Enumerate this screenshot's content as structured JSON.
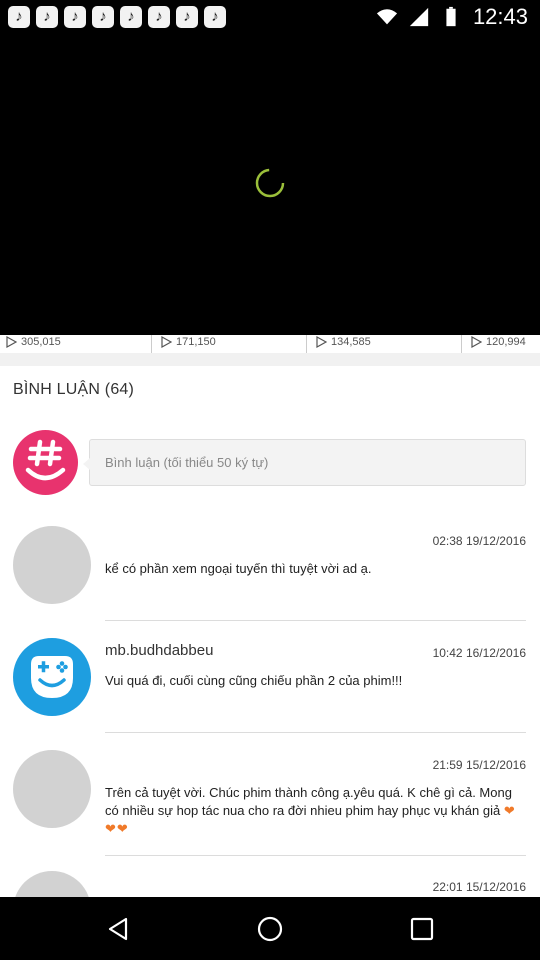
{
  "status_bar": {
    "time": "12:43",
    "notification_icons": [
      "music-note-icon",
      "music-note-icon",
      "music-note-icon",
      "music-note-icon",
      "music-note-icon",
      "music-note-icon",
      "music-note-icon",
      "music-note-icon"
    ],
    "notification_glyph": "♪"
  },
  "related_videos": [
    {
      "views": "305,015"
    },
    {
      "views": "171,150"
    },
    {
      "views": "134,585"
    },
    {
      "views": "120,994"
    }
  ],
  "comments_section": {
    "title": "BÌNH LUẬN (64)",
    "input_placeholder": "Bình luận (tối thiểu 50 ký tự)"
  },
  "comments": [
    {
      "user": "",
      "time": "02:38 19/12/2016",
      "text": "kể có phần xem ngoại tuyến thì tuyệt vời ad ạ.",
      "hearts": ""
    },
    {
      "user": "mb.budhdabbeu",
      "time": "10:42 16/12/2016",
      "text": "Vui quá đi, cuối cùng cũng chiếu phần 2 của phim!!!",
      "hearts": ""
    },
    {
      "user": "",
      "time": "21:59 15/12/2016",
      "text": "Trên cả tuyệt vời. Chúc phim thành công ạ.yêu quá. K chê gì cả. Mong có nhiều sự hop tác nua cho ra đời nhieu phim hay phục vụ khán giả ",
      "hearts": "❤❤❤"
    },
    {
      "user": "",
      "time": "22:01 15/12/2016",
      "text": "",
      "hearts": ""
    }
  ],
  "colors": {
    "accent_pink": "#e8336e",
    "accent_blue": "#1e9ee0",
    "heart_orange": "#f07a2a"
  }
}
